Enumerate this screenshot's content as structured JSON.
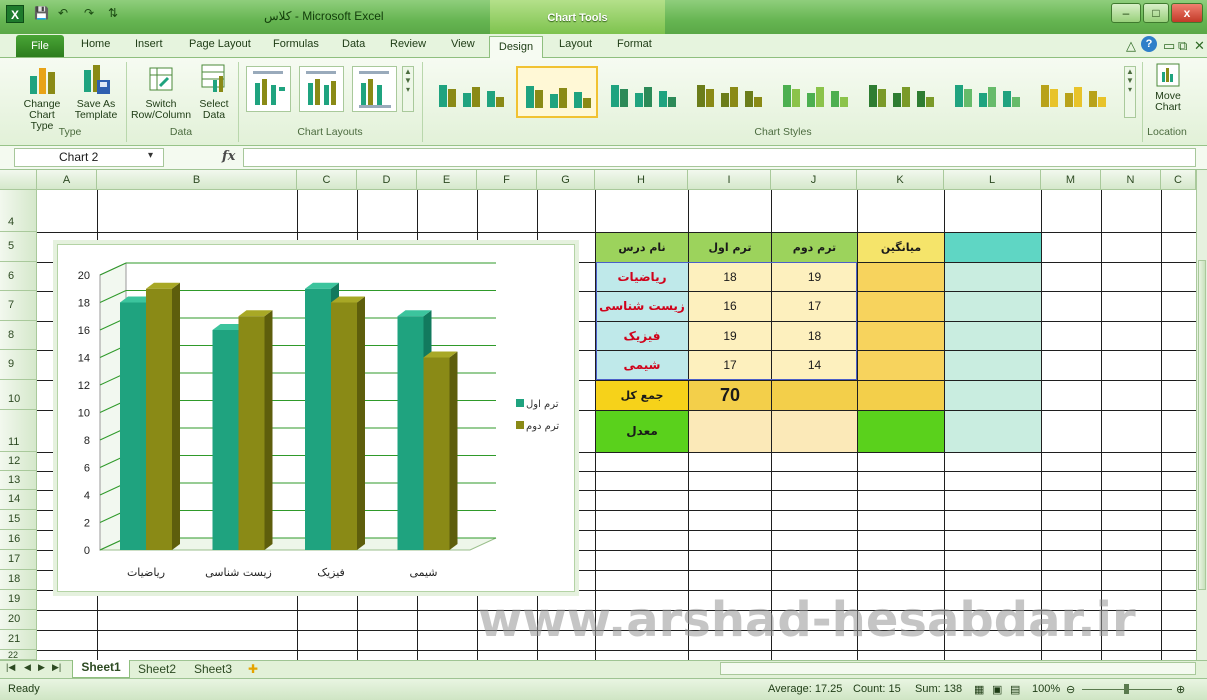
{
  "window": {
    "title": "کلاس - Microsoft Excel",
    "context_tab": "Chart Tools",
    "accent": "#5aa847"
  },
  "quick_access": {
    "save_glyph": "💾",
    "undo_glyph": "↶",
    "redo_glyph": "↷",
    "extra_glyph": "⇅"
  },
  "tabs": [
    "File",
    "Home",
    "Insert",
    "Page Layout",
    "Formulas",
    "Data",
    "Review",
    "View",
    "Design",
    "Layout",
    "Format"
  ],
  "ribbon": {
    "type_group": {
      "label": "Type",
      "buttons": [
        {
          "line1": "Change",
          "line2": "Chart Type"
        },
        {
          "line1": "Save As",
          "line2": "Template"
        }
      ]
    },
    "data_group": {
      "label": "Data",
      "buttons": [
        {
          "line1": "Switch",
          "line2": "Row/Column"
        },
        {
          "line1": "Select",
          "line2": "Data"
        }
      ]
    },
    "layouts_group": {
      "label": "Chart Layouts"
    },
    "styles_group": {
      "label": "Chart Styles"
    },
    "location_group": {
      "label": "Location",
      "button_line1": "Move",
      "button_line2": "Chart"
    }
  },
  "formula_bar": {
    "name_box": "Chart 2",
    "fx": "fx",
    "value": ""
  },
  "columns": [
    "A",
    "B",
    "C",
    "D",
    "E",
    "F",
    "G",
    "H",
    "I",
    "J",
    "K",
    "L",
    "M",
    "N",
    "C"
  ],
  "rows": [
    "4",
    "5",
    "6",
    "7",
    "8",
    "9",
    "10",
    "11",
    "12",
    "13",
    "14",
    "15",
    "16",
    "17",
    "18",
    "19",
    "20",
    "21",
    "22"
  ],
  "table": {
    "headers": {
      "subject": "نام درس",
      "term1": "ترم اول",
      "term2": "ترم دوم",
      "average": "میانگین"
    },
    "rows": [
      {
        "subject": "ریاضیات",
        "term1": "18",
        "term2": "19"
      },
      {
        "subject": "زیست شناسی",
        "term1": "16",
        "term2": "17"
      },
      {
        "subject": "فیزیک",
        "term1": "19",
        "term2": "18"
      },
      {
        "subject": "شیمی",
        "term1": "17",
        "term2": "14"
      }
    ],
    "total_label": "جمع کل",
    "total_value": "70",
    "mean_label": "معدل"
  },
  "chart_data": {
    "type": "bar",
    "categories": [
      "ریاضیات",
      "زیست شناسی",
      "فیزیک",
      "شیمی"
    ],
    "series": [
      {
        "name": "ترم اول",
        "values": [
          18,
          16,
          19,
          17
        ],
        "color": "#1fa37f"
      },
      {
        "name": "ترم دوم",
        "values": [
          19,
          17,
          18,
          14
        ],
        "color": "#8a8a16"
      }
    ],
    "ylim": [
      0,
      20
    ],
    "yticks": [
      "0",
      "2",
      "4",
      "6",
      "8",
      "10",
      "12",
      "14",
      "16",
      "18",
      "20"
    ],
    "grid": true,
    "legend": "right",
    "three_d": true
  },
  "sheets": [
    "Sheet1",
    "Sheet2",
    "Sheet3"
  ],
  "status": {
    "ready": "Ready",
    "average": "Average: 17.25",
    "count": "Count: 15",
    "sum": "Sum: 138",
    "zoom": "100%"
  },
  "watermark": "www.arshad-hesabdar.ir"
}
